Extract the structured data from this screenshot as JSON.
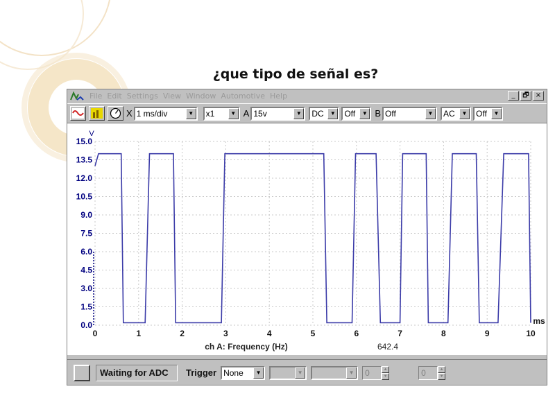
{
  "question": "¿que tipo de señal es?",
  "menu": [
    "File",
    "Edit",
    "Settings",
    "View",
    "Window",
    "Automotive",
    "Help"
  ],
  "window_buttons": [
    "_",
    "🗗",
    "×"
  ],
  "toolbar": {
    "x_label": "X",
    "timebase": "1 ms/div",
    "multiplier": "x1",
    "a_label": "A",
    "a_range": "15v",
    "a_coupling": "DC",
    "a_filter": "Off",
    "b_label": "B",
    "b_range": "Off",
    "b_coupling": "AC",
    "b_filter": "Off"
  },
  "measurement": {
    "label": "ch A: Frequency (Hz)",
    "value": "642.4"
  },
  "status": {
    "state": "Waiting for ADC",
    "trigger_label": "Trigger",
    "trigger_mode": "None",
    "spin1": "0",
    "spin2": "0"
  },
  "colors": {
    "trace": "#3b3ba8",
    "axis_text": "#000080"
  },
  "chart_data": {
    "type": "line",
    "title": "",
    "ylabel": "V",
    "xlabel": "ms",
    "xlim": [
      0,
      10
    ],
    "ylim": [
      0,
      15
    ],
    "grid": true,
    "y_ticks": [
      "15.0",
      "13.5",
      "12.0",
      "10.5",
      "9.0",
      "7.5",
      "6.0",
      "4.5",
      "3.0",
      "1.5",
      "0.0"
    ],
    "x_ticks": [
      "0",
      "1",
      "2",
      "3",
      "4",
      "5",
      "6",
      "7",
      "8",
      "9",
      "10"
    ],
    "series": [
      {
        "x": [
          0,
          0.08,
          0.6,
          0.65,
          1.15,
          1.25,
          1.8,
          1.85,
          2.9,
          2.98,
          5.25,
          5.32,
          5.9,
          5.98,
          6.45,
          6.55,
          7.0,
          7.06,
          7.6,
          7.65,
          8.1,
          8.2,
          8.75,
          8.82,
          9.25,
          9.38,
          9.95,
          10.0
        ],
        "y": [
          13.0,
          14.0,
          14.0,
          0.2,
          0.2,
          14.0,
          14.0,
          0.2,
          0.2,
          14.0,
          14.0,
          0.2,
          0.2,
          14.0,
          14.0,
          0.2,
          0.2,
          14.0,
          14.0,
          0.2,
          0.2,
          14.0,
          14.0,
          0.2,
          0.2,
          14.0,
          14.0,
          0.2
        ]
      }
    ]
  }
}
